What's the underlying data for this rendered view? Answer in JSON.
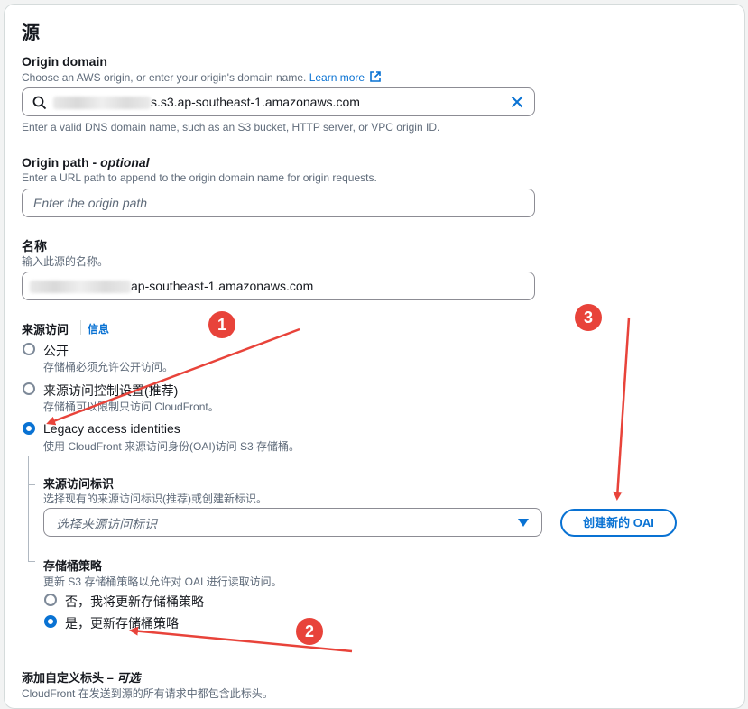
{
  "section": {
    "title": "源"
  },
  "origin_domain": {
    "label": "Origin domain",
    "desc": "Choose an AWS origin, or enter your origin's domain name.",
    "learn_more": "Learn more",
    "value_suffix": "s.s3.ap-southeast-1.amazonaws.com",
    "hint": "Enter a valid DNS domain name, such as an S3 bucket, HTTP server, or VPC origin ID."
  },
  "origin_path": {
    "label": "Origin path - ",
    "label_optional": "optional",
    "desc": "Enter a URL path to append to the origin domain name for origin requests.",
    "placeholder": "Enter the origin path"
  },
  "name": {
    "label": "名称",
    "desc": "输入此源的名称。",
    "value_suffix": "ap-southeast-1.amazonaws.com"
  },
  "origin_access": {
    "label": "来源访问",
    "info": "信息",
    "options": [
      {
        "label": "公开",
        "desc": "存储桶必须允许公开访问。",
        "selected": false
      },
      {
        "label": "来源访问控制设置(推荐)",
        "desc": "存储桶可以限制只访问 CloudFront。",
        "selected": false
      },
      {
        "label": "Legacy access identities",
        "desc": "使用 CloudFront 来源访问身份(OAI)访问 S3 存储桶。",
        "selected": true
      }
    ]
  },
  "oai": {
    "label": "来源访问标识",
    "desc": "选择现有的来源访问标识(推荐)或创建新标识。",
    "placeholder": "选择来源访问标识",
    "create_button": "创建新的 OAI"
  },
  "bucket_policy": {
    "label": "存储桶策略",
    "desc": "更新 S3 存储桶策略以允许对 OAI 进行读取访问。",
    "options": [
      {
        "label": "否，我将更新存储桶策略",
        "selected": false
      },
      {
        "label": "是，更新存储桶策略",
        "selected": true
      }
    ]
  },
  "custom_headers": {
    "label": "添加自定义标头 – ",
    "label_optional": "可选",
    "desc": "CloudFront 在发送到源的所有请求中都包含此标头。"
  },
  "annotations": [
    "1",
    "2",
    "3"
  ],
  "colors": {
    "accent": "#0972d3",
    "annotation": "#e8433a"
  }
}
